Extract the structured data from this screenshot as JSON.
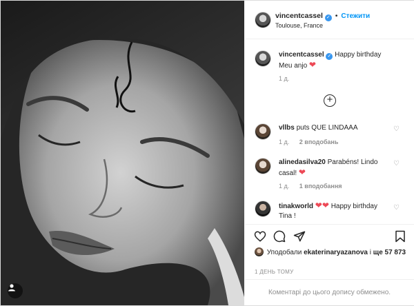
{
  "header": {
    "username": "vincentcassel",
    "verified_glyph": "✓",
    "separator": "•",
    "follow_label": "Стежити",
    "location": "Toulouse, France"
  },
  "caption": {
    "username": "vincentcassel",
    "text": "Happy birthday Meu anjo",
    "emoji": "❤",
    "time": "1 д."
  },
  "load_more": "+",
  "comments": [
    {
      "username": "vllbs",
      "text": "puts QUE LINDAAA",
      "emoji": "",
      "time": "1 д.",
      "likes": "2 вподобань"
    },
    {
      "username": "alinedasilva20",
      "text": "Parabéns! Lindo casal!",
      "emoji": "❤",
      "time": "1 д.",
      "likes": "1 вподобання"
    },
    {
      "username": "tinakworld",
      "text": "Happy birthday Tina !",
      "emoji": "❤❤",
      "time": "",
      "likes": ""
    }
  ],
  "likes": {
    "prefix": "Уподобали",
    "user": "ekaterinaryazanova",
    "middle": "і",
    "and_more": "ще 57 873"
  },
  "post_time": "1 ДЕНЬ ТОМУ",
  "comments_disabled": "Коментарі до цього допису обмежено.",
  "icons": [
    "verified-icon",
    "heart-icon",
    "comment-icon",
    "share-icon",
    "bookmark-icon",
    "user-tag-icon",
    "add-comments-icon",
    "comment-like-icon"
  ],
  "colors": {
    "accent": "#0095f6",
    "heart": "#ed4956",
    "muted": "#8e8e8e",
    "border": "#dbdbdb"
  }
}
